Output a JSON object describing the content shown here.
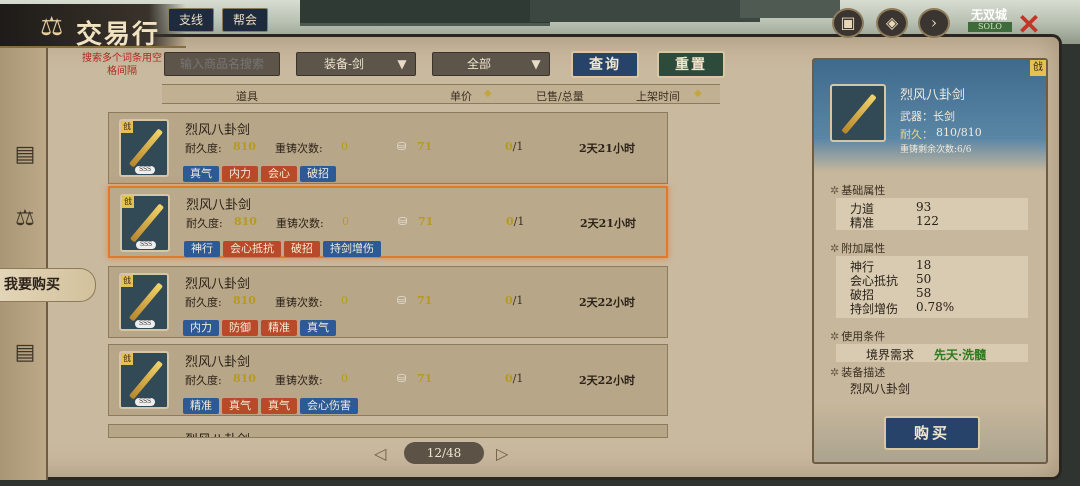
{
  "window": {
    "title": "交易行",
    "tabs": [
      {
        "label": "支线"
      },
      {
        "label": "帮会"
      }
    ],
    "server_name": "无双城",
    "server_sub": "SOLO"
  },
  "search": {
    "hint": "搜索多个词条用空格间隔",
    "placeholder": "输入商品名搜索",
    "category": "装备-剑",
    "range": "全部",
    "query_label": "查询",
    "reset_label": "重置"
  },
  "table": {
    "headers": {
      "item": "道具",
      "price": "单价",
      "sold": "已售/总量",
      "time": "上架时间"
    },
    "durability_label": "耐久度:",
    "reforge_label": "重铸次数:",
    "rows": [
      {
        "name": "烈风八卦剑",
        "durability": "810",
        "reforge": "0",
        "price": "71",
        "sold": "0",
        "total": "/1",
        "time": "2天21小时",
        "tags": [
          {
            "t": "真气",
            "c": "blue"
          },
          {
            "t": "内力",
            "c": "red"
          },
          {
            "t": "会心",
            "c": "red"
          },
          {
            "t": "破招",
            "c": "blue"
          }
        ]
      },
      {
        "name": "烈风八卦剑",
        "durability": "810",
        "reforge": "0",
        "price": "71",
        "sold": "0",
        "total": "/1",
        "time": "2天21小时",
        "tags": [
          {
            "t": "神行",
            "c": "blue"
          },
          {
            "t": "会心抵抗",
            "c": "red"
          },
          {
            "t": "破招",
            "c": "red"
          },
          {
            "t": "持剑增伤",
            "c": "blue"
          }
        ]
      },
      {
        "name": "烈风八卦剑",
        "durability": "810",
        "reforge": "0",
        "price": "71",
        "sold": "0",
        "total": "/1",
        "time": "2天22小时",
        "tags": [
          {
            "t": "内力",
            "c": "blue"
          },
          {
            "t": "防御",
            "c": "red"
          },
          {
            "t": "精准",
            "c": "red"
          },
          {
            "t": "真气",
            "c": "blue"
          }
        ]
      },
      {
        "name": "烈风八卦剑",
        "durability": "810",
        "reforge": "0",
        "price": "71",
        "sold": "0",
        "total": "/1",
        "time": "2天22小时",
        "tags": [
          {
            "t": "精准",
            "c": "blue"
          },
          {
            "t": "真气",
            "c": "red"
          },
          {
            "t": "真气",
            "c": "red"
          },
          {
            "t": "会心伤害",
            "c": "blue"
          }
        ]
      }
    ],
    "partial_row": {
      "name": "烈风八卦剑"
    }
  },
  "pager": {
    "text": "12/48"
  },
  "nav": {
    "buy_tab": "我要购买"
  },
  "detail": {
    "tier": "戗",
    "name": "烈风八卦剑",
    "type": "武器：长剑",
    "durability_label": "耐久：",
    "durability_val": "810/810",
    "reforge_remaining": "重铸剩余次数:6/6",
    "base_title": "基础属性",
    "base": [
      {
        "k": "力道",
        "v": "93"
      },
      {
        "k": "精准",
        "v": "122"
      }
    ],
    "extra_title": "附加属性",
    "extra": [
      {
        "k": "神行",
        "v": "18"
      },
      {
        "k": "会心抵抗",
        "v": "50"
      },
      {
        "k": "破招",
        "v": "58"
      },
      {
        "k": "持剑增伤",
        "v": "0.78%"
      }
    ],
    "req_title": "使用条件",
    "req_label": "境界需求",
    "req_value": "先天·洗髓",
    "desc_title": "装备描述",
    "desc": "烈风八卦剑",
    "buy_label": "购买"
  },
  "icons": {
    "item_tier": "戗",
    "item_level": "SSS"
  },
  "colors": {
    "accent_blue": "#284369",
    "accent_green": "#2d4b3a",
    "selected_border": "#e07a2a",
    "value_gold": "#b69a1f",
    "close_red": "#c33527"
  }
}
